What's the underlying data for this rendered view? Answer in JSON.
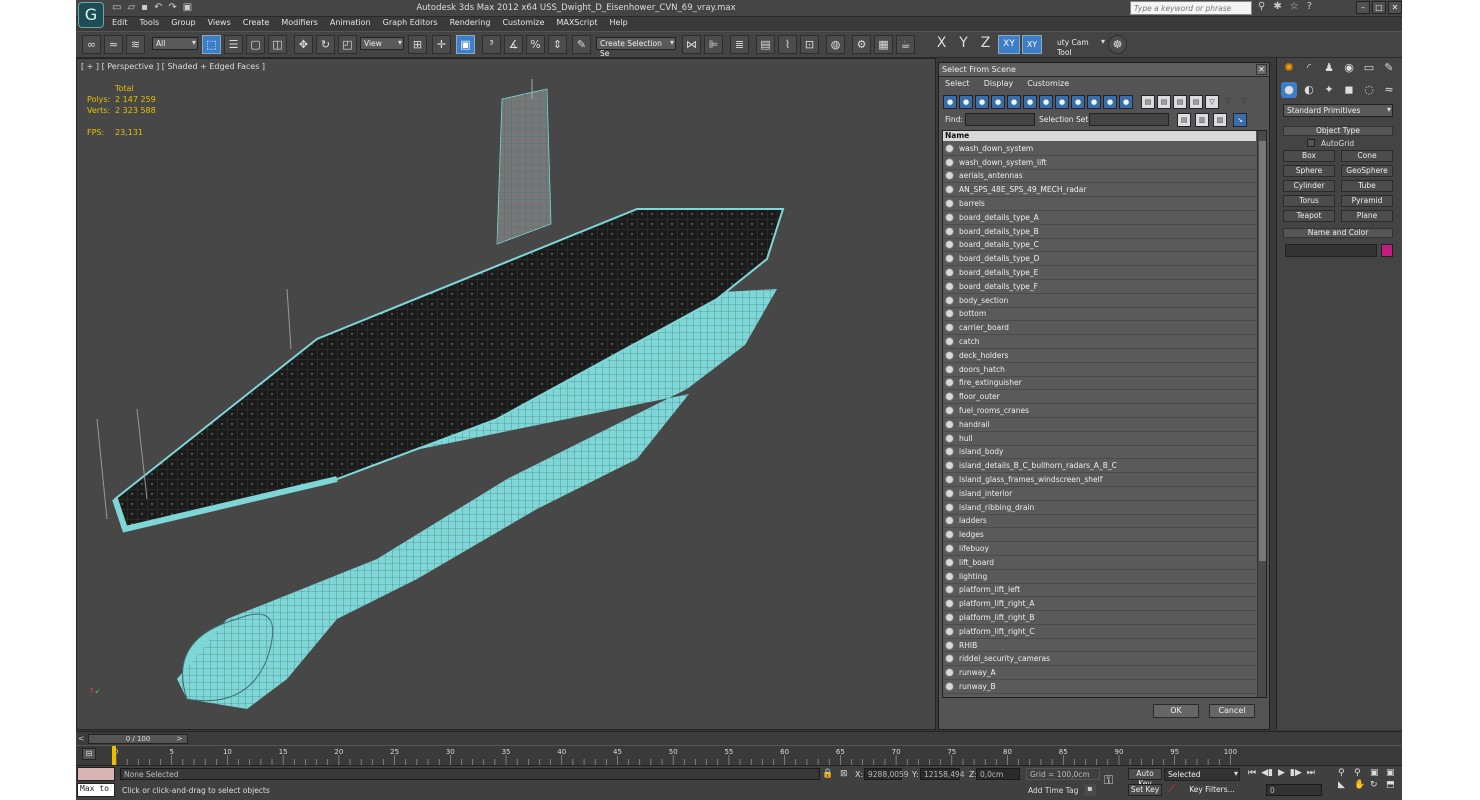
{
  "app": {
    "title": "Autodesk 3ds Max  2012 x64     USS_Dwight_D_Eisenhower_CVN_69_vray.max",
    "search_placeholder": "Type a keyword or phrase"
  },
  "menu": [
    "Edit",
    "Tools",
    "Group",
    "Views",
    "Create",
    "Modifiers",
    "Animation",
    "Graph Editors",
    "Rendering",
    "Customize",
    "MAXScript",
    "Help"
  ],
  "toolbar": {
    "filter": "All",
    "refcoord": "View",
    "selset": "Create Selection Se",
    "camtool": "uty Cam Tool"
  },
  "viewport": {
    "label": "[ + ] [ Perspective ] [ Shaded + Edged Faces ]",
    "stats_header": "Total",
    "polys_label": "Polys:",
    "polys": "2 147 259",
    "verts_label": "Verts:",
    "verts": "2 323 588",
    "fps_label": "FPS:",
    "fps": "23,131"
  },
  "dialog": {
    "title": "Select From Scene",
    "menu": [
      "Select",
      "Display",
      "Customize"
    ],
    "find_label": "Find:",
    "selset_label": "Selection Set:",
    "column": "Name",
    "ok": "OK",
    "cancel": "Cancel",
    "items": [
      "wash_down_system",
      "wash_down_system_lift",
      "aerials_antennas",
      "AN_SPS_48E_SPS_49_MECH_radar",
      "barrels",
      "board_details_type_A",
      "board_details_type_B",
      "board_details_type_C",
      "board_details_type_D",
      "board_details_type_E",
      "board_details_type_F",
      "body_section",
      "bottom",
      "carrier_board",
      "catch",
      "deck_holders",
      "doors_hatch",
      "fire_extinguisher",
      "floor_outer",
      "fuel_rooms_cranes",
      "handrail",
      "hull",
      "island_body",
      "island_details_B_C_bullhorn_radars_A_B_C",
      "Island_glass_frames_windscreen_shelf",
      "island_interior",
      "island_ribbing_drain",
      "ladders",
      "ledges",
      "lifebuoy",
      "lift_board",
      "lighting",
      "platform_lift_left",
      "platform_lift_right_A",
      "platform_lift_right_B",
      "platform_lift_right_C",
      "RHIB",
      "riddel_security_cameras",
      "runway_A",
      "runway_B"
    ]
  },
  "command_panel": {
    "category": "Standard Primitives",
    "object_type": "Object Type",
    "autogrid": "AutoGrid",
    "buttons": [
      "Box",
      "Cone",
      "Sphere",
      "GeoSphere",
      "Cylinder",
      "Tube",
      "Torus",
      "Pyramid",
      "Teapot",
      "Plane"
    ],
    "name_color": "Name and Color"
  },
  "timeline": {
    "slider": "0 / 100",
    "ticks": [
      "0",
      "5",
      "10",
      "15",
      "20",
      "25",
      "30",
      "35",
      "40",
      "45",
      "50",
      "55",
      "60",
      "65",
      "70",
      "75",
      "80",
      "85",
      "90",
      "95",
      "100"
    ]
  },
  "status": {
    "selection": "None Selected",
    "prompt": "Click or click-and-drag to select objects",
    "maxscript": "Max to",
    "x_label": "X:",
    "x": "9288,0059",
    "y_label": "Y:",
    "y": "12158,494",
    "z_label": "Z:",
    "z": "0,0cm",
    "grid": "Grid = 100,0cm",
    "autokey": "Auto Key",
    "autokey_mode": "Selected",
    "setkey": "Set Key",
    "keyfilters": "Key Filters...",
    "addtimetag": "Add Time Tag",
    "frame": "0"
  }
}
